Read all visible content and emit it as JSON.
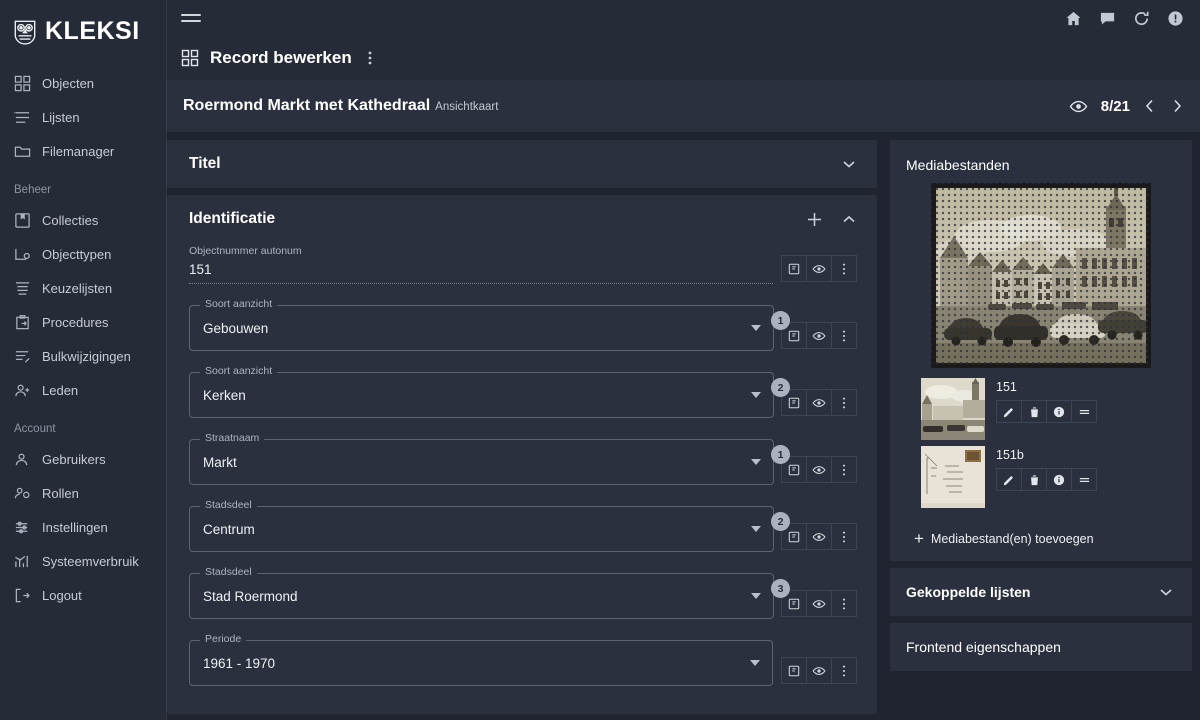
{
  "brand": {
    "name": "KLEKSI",
    "logo_icon": "owl-icon"
  },
  "sidebar": {
    "items": [
      {
        "label": "Objecten",
        "icon": "grid-icon"
      },
      {
        "label": "Lijsten",
        "icon": "list-icon"
      },
      {
        "label": "Filemanager",
        "icon": "folder-icon"
      }
    ],
    "section_beheer": "Beheer",
    "beheer_items": [
      {
        "label": "Collecties",
        "icon": "book-icon"
      },
      {
        "label": "Objecttypen",
        "icon": "object-type-icon"
      },
      {
        "label": "Keuzelijsten",
        "icon": "choice-list-icon"
      },
      {
        "label": "Procedures",
        "icon": "clipboard-icon"
      },
      {
        "label": "Bulkwijzigingen",
        "icon": "bulk-edit-icon"
      },
      {
        "label": "Leden",
        "icon": "members-icon"
      }
    ],
    "section_account": "Account",
    "account_items": [
      {
        "label": "Gebruikers",
        "icon": "users-icon"
      },
      {
        "label": "Rollen",
        "icon": "roles-icon"
      },
      {
        "label": "Instellingen",
        "icon": "sliders-icon"
      },
      {
        "label": "Systeemverbruik",
        "icon": "chart-icon"
      },
      {
        "label": "Logout",
        "icon": "logout-icon"
      }
    ]
  },
  "topbar": {
    "menu_icon": "hamburger-icon",
    "icons": [
      {
        "name": "home-icon"
      },
      {
        "name": "chat-icon"
      },
      {
        "name": "refresh-icon"
      },
      {
        "name": "alert-icon"
      }
    ]
  },
  "page": {
    "grid_icon": "grid-icon",
    "title": "Record bewerken",
    "kebab_icon": "more-vertical-icon"
  },
  "record": {
    "title": "Roermond Markt met Kathedraal",
    "subtitle": "Ansichtkaart",
    "eye_icon": "eye-icon",
    "counter": "8/21",
    "prev_icon": "chevron-left-icon",
    "next_icon": "chevron-right-icon"
  },
  "panels": {
    "titel": {
      "title": "Titel",
      "toggle_icon": "chevron-down-icon"
    },
    "identificatie": {
      "title": "Identificatie",
      "add_icon": "plus-icon",
      "toggle_icon": "chevron-up-icon"
    }
  },
  "row_actions": {
    "note_icon": "note-icon",
    "eye_icon": "eye-icon",
    "menu_icon": "more-vertical-icon"
  },
  "fields": [
    {
      "kind": "text",
      "label": "Objectnummer autonum",
      "value": "151",
      "badge": ""
    },
    {
      "kind": "select",
      "label": "Soort aanzicht",
      "value": "Gebouwen",
      "badge": "1"
    },
    {
      "kind": "select",
      "label": "Soort aanzicht",
      "value": "Kerken",
      "badge": "2"
    },
    {
      "kind": "select",
      "label": "Straatnaam",
      "value": "Markt",
      "badge": "1"
    },
    {
      "kind": "select",
      "label": "Stadsdeel",
      "value": "Centrum",
      "badge": "2"
    },
    {
      "kind": "select",
      "label": "Stadsdeel",
      "value": "Stad Roermond",
      "badge": "3"
    },
    {
      "kind": "select",
      "label": "Periode",
      "value": "1961 - 1970",
      "badge": ""
    }
  ],
  "media": {
    "title": "Mediabestanden",
    "hero_alt": "Roermond Markt met Kathedraal postcard",
    "items": [
      {
        "name": "151",
        "actions": [
          {
            "icon": "pencil-icon"
          },
          {
            "icon": "trash-icon"
          },
          {
            "icon": "info-icon"
          },
          {
            "icon": "drag-handle-icon"
          }
        ]
      },
      {
        "name": "151b",
        "actions": [
          {
            "icon": "pencil-icon"
          },
          {
            "icon": "trash-icon"
          },
          {
            "icon": "info-icon"
          },
          {
            "icon": "drag-handle-icon"
          }
        ]
      }
    ],
    "add_label": "Mediabestand(en) toevoegen",
    "add_icon": "plus-icon"
  },
  "right_panels": [
    {
      "title": "Gekoppelde lijsten",
      "toggle_icon": "chevron-down-icon",
      "has_toggle": true
    },
    {
      "title": "Frontend eigenschappen",
      "toggle_icon": "",
      "has_toggle": false
    }
  ],
  "colors": {
    "sidebar_bg": "#262b38",
    "app_bg": "#1f2430",
    "panel_bg": "#2a303d",
    "text": "#e8eaee",
    "muted": "#aeb5c1",
    "badge_bg": "#aab2c0"
  }
}
